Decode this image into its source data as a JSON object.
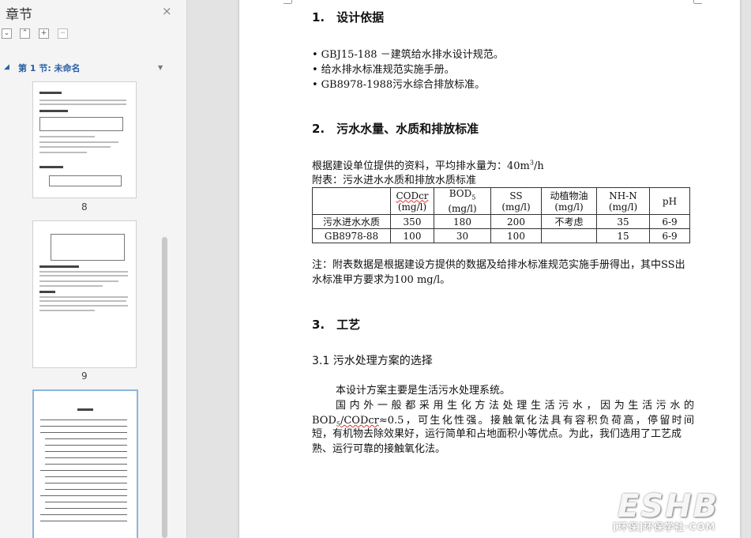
{
  "sidebar": {
    "title": "章节",
    "close_icon": "×",
    "tool_icons": [
      "expand-all-icon",
      "collapse-all-icon",
      "add-section-icon",
      "remove-section-icon"
    ],
    "tool_glyphs": [
      "⌄",
      "⌃",
      "+",
      "−"
    ],
    "section_label": "第 1 节: 未命名",
    "pages": [
      "8",
      "9"
    ],
    "accent": "#2a5fa8"
  },
  "doc": {
    "sec1_title": "1.　设计依据",
    "sec1_items": [
      "GBJ15-188 －建筑给水排水设计规范。",
      "给水排水标准规范实施手册。",
      "GB8978-1988污水综合排放标准。"
    ],
    "sec2_title": "2.　污水水量、水质和排放标准",
    "flow_text_before": "根据建设单位提供的资料，平均排水量为：40m",
    "flow_sup": "3",
    "flow_text_after": "/h",
    "table_caption": "附表：污水进水水质和排放水质标准",
    "table_header": {
      "blank": "",
      "cod_label": "CODcr",
      "bod_label": "BOD",
      "bod_sub": "5",
      "ss_label": "SS",
      "oil_label": "动植物油",
      "nh_label": "NH-N",
      "ph_label": "pH",
      "unit": "(mg/l)"
    },
    "table_rows": [
      [
        "污水进水水质",
        "350",
        "180",
        "200",
        "不考虑",
        "35",
        "6-9"
      ],
      [
        "GB8978-88",
        "100",
        "30",
        "100",
        "",
        "15",
        "6-9"
      ]
    ],
    "note": "注：附表数据是根据建设方提供的数据及给排水标准规范实施手册得出，其中SS出水标准甲方要求为100 mg/l。",
    "sec3_title": "3.　工艺",
    "sec31_title": "3.1 污水处理方案的选择",
    "p1": "本设计方案主要是生活污水处理系统。",
    "p2_line1": "国内外一般都采用生化方法处理生活污水，因为生活污水的",
    "p2_bod": "BOD",
    "p2_bod_sub": "5",
    "p2_cod": "/CODcr",
    "p2_rest_l2": "≈0.5，可生化性强。接触氧化法具有容积负荷高，停留时间",
    "p2_rest": "短，有机物去除效果好，运行简单和占地面积小等优点。为此，我们选用了工艺成熟、运行可靠的接触氧化法。"
  },
  "watermark": {
    "logo": "ESHB",
    "sub": "[环保]环保学社·COM"
  }
}
